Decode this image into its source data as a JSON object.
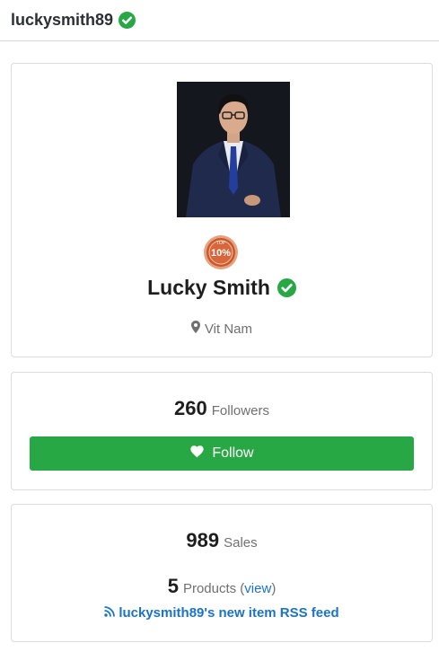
{
  "header": {
    "username": "luckysmith89",
    "verified_icon": "check-circle-icon"
  },
  "profile": {
    "name": "Lucky Smith",
    "location": "Vit Nam",
    "badge_text": "10%",
    "badge_top": "TOP",
    "location_icon": "map-marker-icon"
  },
  "followers": {
    "count": "260",
    "label": "Followers",
    "button_label": "Follow",
    "button_icon": "heart-icon"
  },
  "sales": {
    "count": "989",
    "label": "Sales",
    "products_count": "5",
    "products_label": "Products (",
    "view_label": "view",
    "products_close": ")",
    "rss_label": "luckysmith89's new item RSS feed",
    "rss_icon": "rss-icon"
  },
  "colors": {
    "verified_green": "#28a745",
    "button_green": "#28a745",
    "link_blue": "#1a73c9",
    "badge_orange": "#c9572a"
  }
}
